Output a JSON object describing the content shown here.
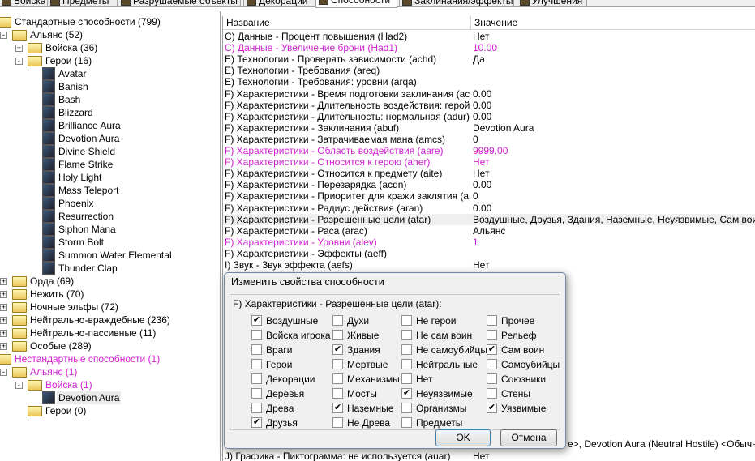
{
  "tabs": [
    {
      "label": "Войска"
    },
    {
      "label": "Предметы"
    },
    {
      "label": "Разрушаемые объекты"
    },
    {
      "label": "Декорации"
    },
    {
      "label": "Способности",
      "selected": true
    },
    {
      "label": "Заклинания/эффекты"
    },
    {
      "label": "Улучшения"
    }
  ],
  "tree": [
    {
      "label": "Стандартные способности (799)",
      "level": 0,
      "type": "folder"
    },
    {
      "label": "Альянс (52)",
      "level": 1,
      "type": "folder",
      "expander": "-"
    },
    {
      "label": "Войска (36)",
      "level": 2,
      "type": "folder",
      "expander": "+"
    },
    {
      "label": "Герои (16)",
      "level": 2,
      "type": "folder",
      "expander": "-"
    },
    {
      "label": "Avatar",
      "level": 3,
      "type": "ability"
    },
    {
      "label": "Banish",
      "level": 3,
      "type": "ability"
    },
    {
      "label": "Bash",
      "level": 3,
      "type": "ability"
    },
    {
      "label": "Blizzard",
      "level": 3,
      "type": "ability"
    },
    {
      "label": "Brilliance Aura",
      "level": 3,
      "type": "ability"
    },
    {
      "label": "Devotion Aura",
      "level": 3,
      "type": "ability"
    },
    {
      "label": "Divine Shield",
      "level": 3,
      "type": "ability"
    },
    {
      "label": "Flame Strike",
      "level": 3,
      "type": "ability"
    },
    {
      "label": "Holy Light",
      "level": 3,
      "type": "ability"
    },
    {
      "label": "Mass Teleport",
      "level": 3,
      "type": "ability"
    },
    {
      "label": "Phoenix",
      "level": 3,
      "type": "ability"
    },
    {
      "label": "Resurrection",
      "level": 3,
      "type": "ability"
    },
    {
      "label": "Siphon Mana",
      "level": 3,
      "type": "ability"
    },
    {
      "label": "Storm Bolt",
      "level": 3,
      "type": "ability"
    },
    {
      "label": "Summon Water Elemental",
      "level": 3,
      "type": "ability"
    },
    {
      "label": "Thunder Clap",
      "level": 3,
      "type": "ability"
    },
    {
      "label": "Орда (69)",
      "level": 1,
      "type": "folder",
      "expander": "+"
    },
    {
      "label": "Нежить (70)",
      "level": 1,
      "type": "folder",
      "expander": "+"
    },
    {
      "label": "Ночные эльфы (72)",
      "level": 1,
      "type": "folder",
      "expander": "+"
    },
    {
      "label": "Нейтрально-враждебные (236)",
      "level": 1,
      "type": "folder",
      "expander": "+"
    },
    {
      "label": "Нейтрально-пассивные (11)",
      "level": 1,
      "type": "folder",
      "expander": "+"
    },
    {
      "label": "Особые (289)",
      "level": 1,
      "type": "folder",
      "expander": "+"
    },
    {
      "label": "Нестандартные способности (1)",
      "level": 0,
      "type": "folder",
      "modified": true
    },
    {
      "label": "Альянс (1)",
      "level": 1,
      "type": "folder",
      "expander": "-",
      "modified": true
    },
    {
      "label": "Войска (1)",
      "level": 2,
      "type": "folder",
      "expander": "-",
      "modified": true
    },
    {
      "label": "Devotion Aura",
      "level": 3,
      "type": "ability",
      "selected": true
    },
    {
      "label": "Герои (0)",
      "level": 2,
      "type": "folder"
    }
  ],
  "list": {
    "headers": [
      "Название",
      "Значение"
    ],
    "rows": [
      {
        "name": "C) Данные - Процент повышения (Had2)",
        "value": "Нет"
      },
      {
        "name": "C) Данные - Увеличение брони (Had1)",
        "value": "10.00",
        "modified": true
      },
      {
        "name": "E) Технологии - Проверять зависимости (achd)",
        "value": "Да"
      },
      {
        "name": "E) Технологии - Требования (areq)",
        "value": ""
      },
      {
        "name": "E) Технологии - Требования: уровни (arqa)",
        "value": ""
      },
      {
        "name": "F) Характеристики - Время подготовки заклинания (acas)",
        "value": "0.00"
      },
      {
        "name": "F) Характеристики - Длительность воздействия: герой (...",
        "value": "0.00"
      },
      {
        "name": "F) Характеристики - Длительность: нормальная (adur)",
        "value": "0.00"
      },
      {
        "name": "F) Характеристики - Заклинания (abuf)",
        "value": "Devotion Aura"
      },
      {
        "name": "F) Характеристики - Затрачиваемая мана (amcs)",
        "value": "0"
      },
      {
        "name": "F) Характеристики - Область воздействия (aare)",
        "value": "9999.00",
        "modified": true
      },
      {
        "name": "F) Характеристики - Относится к герою (aher)",
        "value": "Нет",
        "modified": true
      },
      {
        "name": "F) Характеристики - Относится к предмету (aite)",
        "value": "Нет"
      },
      {
        "name": "F) Характеристики - Перезарядка (acdn)",
        "value": "0.00"
      },
      {
        "name": "F) Характеристики - Приоритет для кражи заклятия (apri)",
        "value": "0"
      },
      {
        "name": "F) Характеристики - Радиус действия (aran)",
        "value": "0.00"
      },
      {
        "name": "F) Характеристики - Разрешенные цели (atar)",
        "value": "Воздушные, Друзья, Здания, Наземные, Неуязвимые, Сам воин, Уязвимые",
        "highlighted": true
      },
      {
        "name": "F) Характеристики - Раса (arac)",
        "value": "Альянс"
      },
      {
        "name": "F) Характеристики - Уровни (alev)",
        "value": "1",
        "modified": true
      },
      {
        "name": "F) Характеристики - Эффекты (aeff)",
        "value": ""
      },
      {
        "name": "I) Звук - Звук эффекта (aefs)",
        "value": "Нет"
      }
    ],
    "partial_row_value": "е>, Devotion Aura (Neutral Hostile) <Обычные>",
    "last_row": {
      "name": "J) Графика - Пиктограмма: не используется (auar)",
      "value": "Нет"
    }
  },
  "dialog": {
    "title": "Изменить свойства способности",
    "group_label": "F) Характеристики - Разрешенные цели (atar):",
    "columns": [
      [
        {
          "label": "Воздушные",
          "checked": true
        },
        {
          "label": "Войска игрока",
          "checked": false
        },
        {
          "label": "Враги",
          "checked": false
        },
        {
          "label": "Герои",
          "checked": false
        },
        {
          "label": "Декорации",
          "checked": false
        },
        {
          "label": "Деревья",
          "checked": false
        },
        {
          "label": "Древа",
          "checked": false
        },
        {
          "label": "Друзья",
          "checked": true
        }
      ],
      [
        {
          "label": "Духи",
          "checked": false
        },
        {
          "label": "Живые",
          "checked": false
        },
        {
          "label": "Здания",
          "checked": true
        },
        {
          "label": "Мертвые",
          "checked": false
        },
        {
          "label": "Механизмы",
          "checked": false
        },
        {
          "label": "Мосты",
          "checked": false
        },
        {
          "label": "Наземные",
          "checked": true
        },
        {
          "label": "Не Древа",
          "checked": false
        }
      ],
      [
        {
          "label": "Не герои",
          "checked": false
        },
        {
          "label": "Не сам воин",
          "checked": false
        },
        {
          "label": "Не самоубийцы",
          "checked": false
        },
        {
          "label": "Нейтральные",
          "checked": false
        },
        {
          "label": "Нет",
          "checked": false
        },
        {
          "label": "Неуязвимые",
          "checked": true
        },
        {
          "label": "Организмы",
          "checked": false
        },
        {
          "label": "Предметы",
          "checked": false
        }
      ],
      [
        {
          "label": "Прочее",
          "checked": false
        },
        {
          "label": "Рельеф",
          "checked": false
        },
        {
          "label": "Сам воин",
          "checked": true
        },
        {
          "label": "Самоубийцы",
          "checked": false
        },
        {
          "label": "Союзники",
          "checked": false
        },
        {
          "label": "Стены",
          "checked": false
        },
        {
          "label": "Уязвимые",
          "checked": true
        }
      ]
    ],
    "ok_label": "OK",
    "cancel_label": "Отмена"
  },
  "colors": {
    "modified": "#d020d0"
  }
}
